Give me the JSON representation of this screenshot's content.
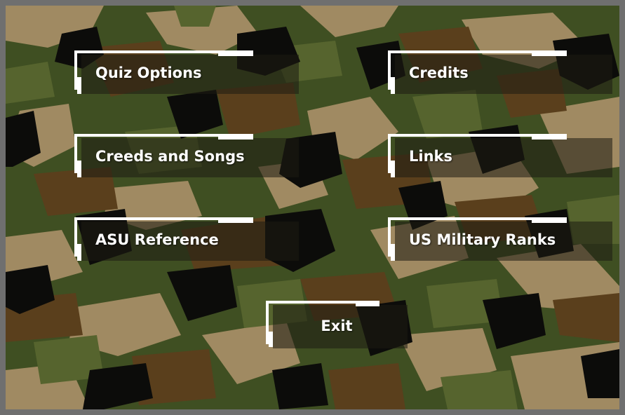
{
  "colors": {
    "frame": "#6f6f6f",
    "camo_green": "#3f4f22",
    "camo_dark": "#0c0c0a",
    "camo_tan": "#a08a62",
    "camo_brown": "#5a3f1c",
    "camo_olive": "#56642e",
    "button_text": "#ffffff",
    "button_panel": "rgba(30, 28, 18, 0.55)"
  },
  "menu": {
    "buttons": [
      {
        "label": "Quiz Options"
      },
      {
        "label": "Credits"
      },
      {
        "label": "Creeds and Songs"
      },
      {
        "label": "Links"
      },
      {
        "label": "ASU Reference"
      },
      {
        "label": "US Military Ranks"
      }
    ],
    "exit_label": "Exit"
  }
}
